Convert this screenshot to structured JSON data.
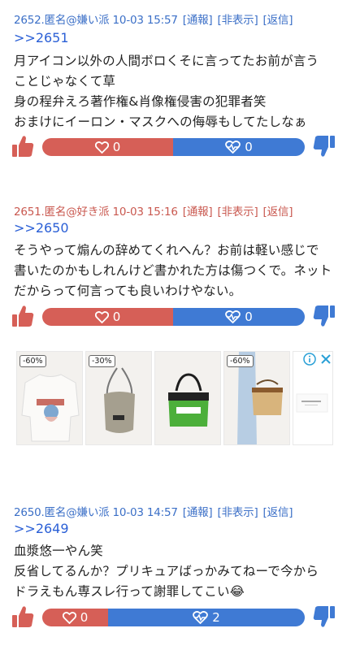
{
  "posts": [
    {
      "header": "2652.匿名@嫌い派 10-03 15:57",
      "actions": [
        "[通報]",
        "[非表示]",
        "[返信]"
      ],
      "reply": ">>2651",
      "lines": [
        "月アイコン以外の人間ボロくそに言ってたお前が言う",
        "ことじゃなくて草",
        "身の程弁えろ著作権&肖像権侵害の犯罪者笑",
        "おまけにイーロン・マスクへの侮辱もしてたしなぁ"
      ],
      "good_count": "0",
      "bad_count": "0",
      "good_share": 0.5
    },
    {
      "header": "2651.匿名@好き派 10-03 15:16",
      "actions": [
        "[通報]",
        "[非表示]",
        "[返信]"
      ],
      "reply": ">>2650",
      "lines": [
        "そうやって煽んの辞めてくれへん？お前は軽い感じで",
        "書いたのかもしれんけど書かれた方は傷つくで。ネット",
        "だからって何言っても良いわけやない。"
      ],
      "good_count": "0",
      "bad_count": "0",
      "good_share": 0.5
    },
    {
      "header": "2650.匿名@嫌い派 10-03 14:57",
      "actions": [
        "[通報]",
        "[非表示]",
        "[返信]"
      ],
      "reply": ">>2649",
      "lines": [
        "血漿悠一やん笑",
        "反省してるんか？プリキュアばっかみてねーで今から",
        "ドラえもん専スレ行って謝罪してこい😂"
      ],
      "good_count": "0",
      "bad_count": "2",
      "good_share": 0.25
    }
  ],
  "ad": {
    "discounts": [
      "-60%",
      "-30%",
      "",
      "-60%"
    ]
  },
  "colors": {
    "good": "#d65f57",
    "bad": "#3f7ad4",
    "link": "#2a5fd6",
    "header_dislike": "#3b6fc7",
    "header_like": "#c9584f"
  }
}
